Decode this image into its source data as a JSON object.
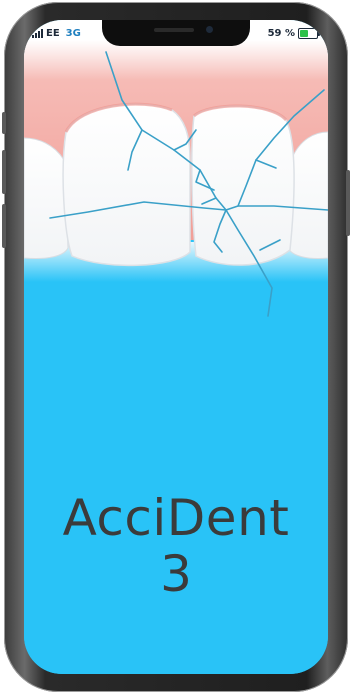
{
  "status_bar": {
    "carrier": "EE",
    "network": "3G",
    "battery": "59 %",
    "battery_level": 0.59,
    "icons": [
      "signal-icon",
      "battery-icon"
    ]
  },
  "splash": {
    "title_line1": "AcciDent",
    "title_line2": "3"
  },
  "colors": {
    "background_blue": "#29c3f7",
    "gum_pink": "#f4b3ae",
    "crack_blue": "#3aa0c8",
    "title_text": "#3b3b3b"
  }
}
